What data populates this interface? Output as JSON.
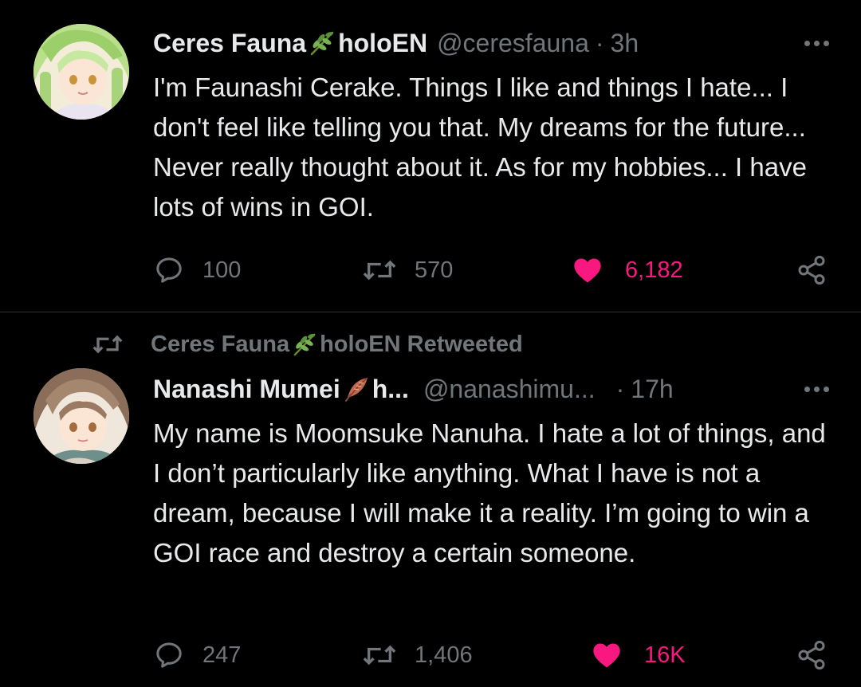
{
  "tweets": [
    {
      "author_name": "Ceres Fauna",
      "author_emoji": "herb-emoji",
      "author_name_suffix": "holoEN",
      "handle": "@ceresfauna",
      "separator": "·",
      "time": "3h",
      "text": "I'm Faunashi Cerake. Things I like and things I hate... I don't feel like telling you that. My dreams for the future... Never really thought about it. As for my hobbies... I have lots of wins in GOI.",
      "replies": "100",
      "retweets": "570",
      "likes": "6,182",
      "liked": true
    },
    {
      "retweeted_by": {
        "name": "Ceres Fauna",
        "emoji": "herb-emoji",
        "suffix": "holoEN Retweeted"
      },
      "author_name": "Nanashi Mumei",
      "author_emoji": "feather-emoji",
      "author_name_suffix": "h...",
      "handle": "@nanashimu...",
      "separator": "·",
      "time": "17h",
      "text": "My name is Moomsuke Nanuha. I hate a lot of things, and I don’t particularly like anything. What I have is not a dream, because I will make it a reality. I’m going to win a GOI race and destroy a certain someone.",
      "replies": "247",
      "retweets": "1,406",
      "likes": "16K",
      "liked": true
    }
  ],
  "colors": {
    "background": "#000000",
    "text": "#e7e9ea",
    "muted": "#71767b",
    "like": "#f91880",
    "divider": "#2f3336"
  }
}
